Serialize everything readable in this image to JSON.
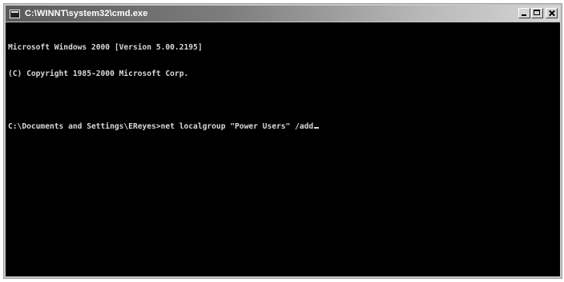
{
  "window": {
    "title": "C:\\WINNT\\system32\\cmd.exe",
    "icon": "console-icon",
    "controls": [
      "minimize",
      "maximize",
      "close"
    ]
  },
  "console": {
    "lines": [
      "Microsoft Windows 2000 [Version 5.00.2195]",
      "(C) Copyright 1985-2000 Microsoft Corp.",
      "",
      "C:\\Documents and Settings\\EReyes>net localgroup \"Power Users\" /add"
    ],
    "colors": {
      "background": "#000000",
      "foreground": "#d8d8d8"
    }
  }
}
